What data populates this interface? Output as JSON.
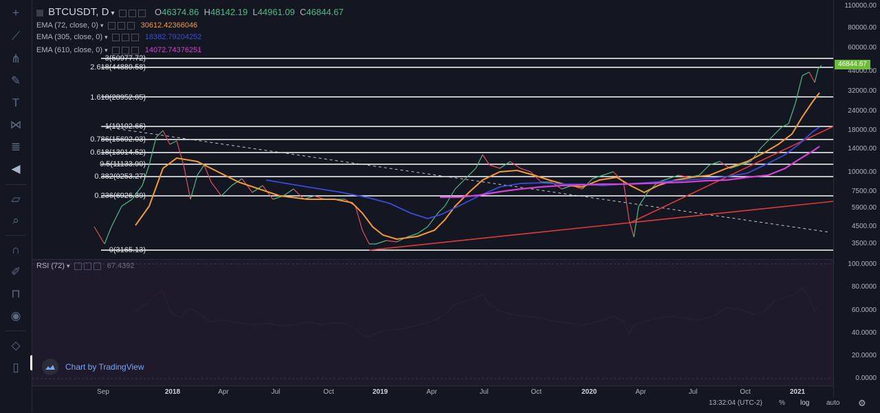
{
  "symbol": {
    "name": "BTCUSDT, D",
    "o_label": "O",
    "o": "46374.86",
    "h_label": "H",
    "h": "48142.19",
    "l_label": "L",
    "l": "44961.09",
    "c_label": "C",
    "c": "46844.67"
  },
  "indicators": [
    {
      "label": "EMA (72, close, 0)",
      "value": "30612.42366046",
      "color": "#f59b33"
    },
    {
      "label": "EMA (305, close, 0)",
      "value": "18382.79204252",
      "color": "#3b4bd8"
    },
    {
      "label": "EMA (610, close, 0)",
      "value": "14072.74376251",
      "color": "#d442d4"
    }
  ],
  "fib_levels": [
    {
      "label": "3(50977.72)"
    },
    {
      "label": "2.618(44889.58)"
    },
    {
      "label": "1.618(28952.05)"
    },
    {
      "label": "1(19102.66)"
    },
    {
      "label": "0.786(15692.03)"
    },
    {
      "label": "0.618(13014.52)"
    },
    {
      "label": "0.5(11133.90)"
    },
    {
      "label": "0.382(9253.27)"
    },
    {
      "label": "0.236(6926.39)"
    },
    {
      "label": "0(3165.13)"
    }
  ],
  "price_axis": [
    "110000.00",
    "80000.00",
    "60000.00",
    "44000.00",
    "32000.00",
    "24000.00",
    "18000.00",
    "14000.00",
    "10000.00",
    "7500.00",
    "5900.00",
    "4500.00",
    "3500.00"
  ],
  "last_price": "46844.67",
  "rsi": {
    "label": "RSI (72)",
    "value": "67.4392",
    "axis": [
      "100.0000",
      "80.0000",
      "60.0000",
      "40.0000",
      "20.0000",
      "0.0000"
    ]
  },
  "time_axis": [
    {
      "label": "Sep",
      "year": false
    },
    {
      "label": "2018",
      "year": true
    },
    {
      "label": "Apr",
      "year": false
    },
    {
      "label": "Jul",
      "year": false
    },
    {
      "label": "Oct",
      "year": false
    },
    {
      "label": "2019",
      "year": true
    },
    {
      "label": "Apr",
      "year": false
    },
    {
      "label": "Jul",
      "year": false
    },
    {
      "label": "Oct",
      "year": false
    },
    {
      "label": "2020",
      "year": true
    },
    {
      "label": "Apr",
      "year": false
    },
    {
      "label": "Jul",
      "year": false
    },
    {
      "label": "Oct",
      "year": false
    },
    {
      "label": "2021",
      "year": true
    }
  ],
  "footer": {
    "time": "13:32:04 (UTC-2)",
    "percent": "%",
    "log": "log",
    "auto": "auto"
  },
  "branding": {
    "text": "Chart by TradingView"
  },
  "colors": {
    "fib": "#ffffff",
    "trend": "#e03b3b",
    "ema72": "#f59b33",
    "ema305": "#3b4bd8",
    "ema610": "#d442d4",
    "up": "#53b987",
    "down": "#eb4d5c",
    "rsi": "#2a1f2e",
    "badge": "#6dbb36"
  },
  "toolbar_icons": [
    "crosshair-icon",
    "trend-line-icon",
    "pitchfork-icon",
    "brush-icon",
    "text-icon",
    "pattern-icon",
    "fib-tools-icon",
    "back-arrow-icon",
    "ruler-icon",
    "zoom-icon",
    "magnet-icon",
    "lock-drawing-icon",
    "lock-icon",
    "eye-icon",
    "layers-icon",
    "trash-icon"
  ]
}
